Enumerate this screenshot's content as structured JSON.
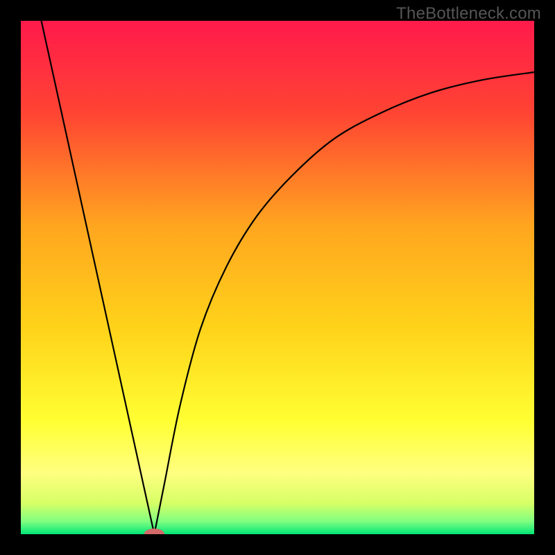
{
  "watermark": "TheBottleneck.com",
  "chart_data": {
    "type": "line",
    "title": "",
    "xlabel": "",
    "ylabel": "",
    "xlim": [
      0,
      100
    ],
    "ylim": [
      0,
      100
    ],
    "grid": false,
    "legend": false,
    "background": {
      "type": "vertical-gradient",
      "stops": [
        {
          "offset": 0.0,
          "color": "#ff1a4b"
        },
        {
          "offset": 0.18,
          "color": "#ff4433"
        },
        {
          "offset": 0.4,
          "color": "#ffa61f"
        },
        {
          "offset": 0.6,
          "color": "#ffd31a"
        },
        {
          "offset": 0.78,
          "color": "#ffff33"
        },
        {
          "offset": 0.88,
          "color": "#ffff80"
        },
        {
          "offset": 0.94,
          "color": "#d6ff66"
        },
        {
          "offset": 0.975,
          "color": "#80ff80"
        },
        {
          "offset": 1.0,
          "color": "#00e676"
        }
      ]
    },
    "series": [
      {
        "name": "left-curve",
        "x": [
          4,
          26
        ],
        "y": [
          100,
          0
        ],
        "style": "line"
      },
      {
        "name": "right-curve",
        "x": [
          26,
          28,
          31,
          35,
          40,
          46,
          53,
          61,
          70,
          80,
          90,
          100
        ],
        "y": [
          0,
          10,
          25,
          40,
          52,
          62,
          70,
          77,
          82,
          86,
          88.5,
          90
        ],
        "style": "line"
      }
    ],
    "markers": [
      {
        "name": "minimum-point",
        "x": 26,
        "y": 0,
        "shape": "oval",
        "color": "#d26a6a",
        "rx": 2.0,
        "ry": 1.1
      }
    ]
  },
  "frame": {
    "border_color": "#000000",
    "outer_background": "#000000"
  }
}
